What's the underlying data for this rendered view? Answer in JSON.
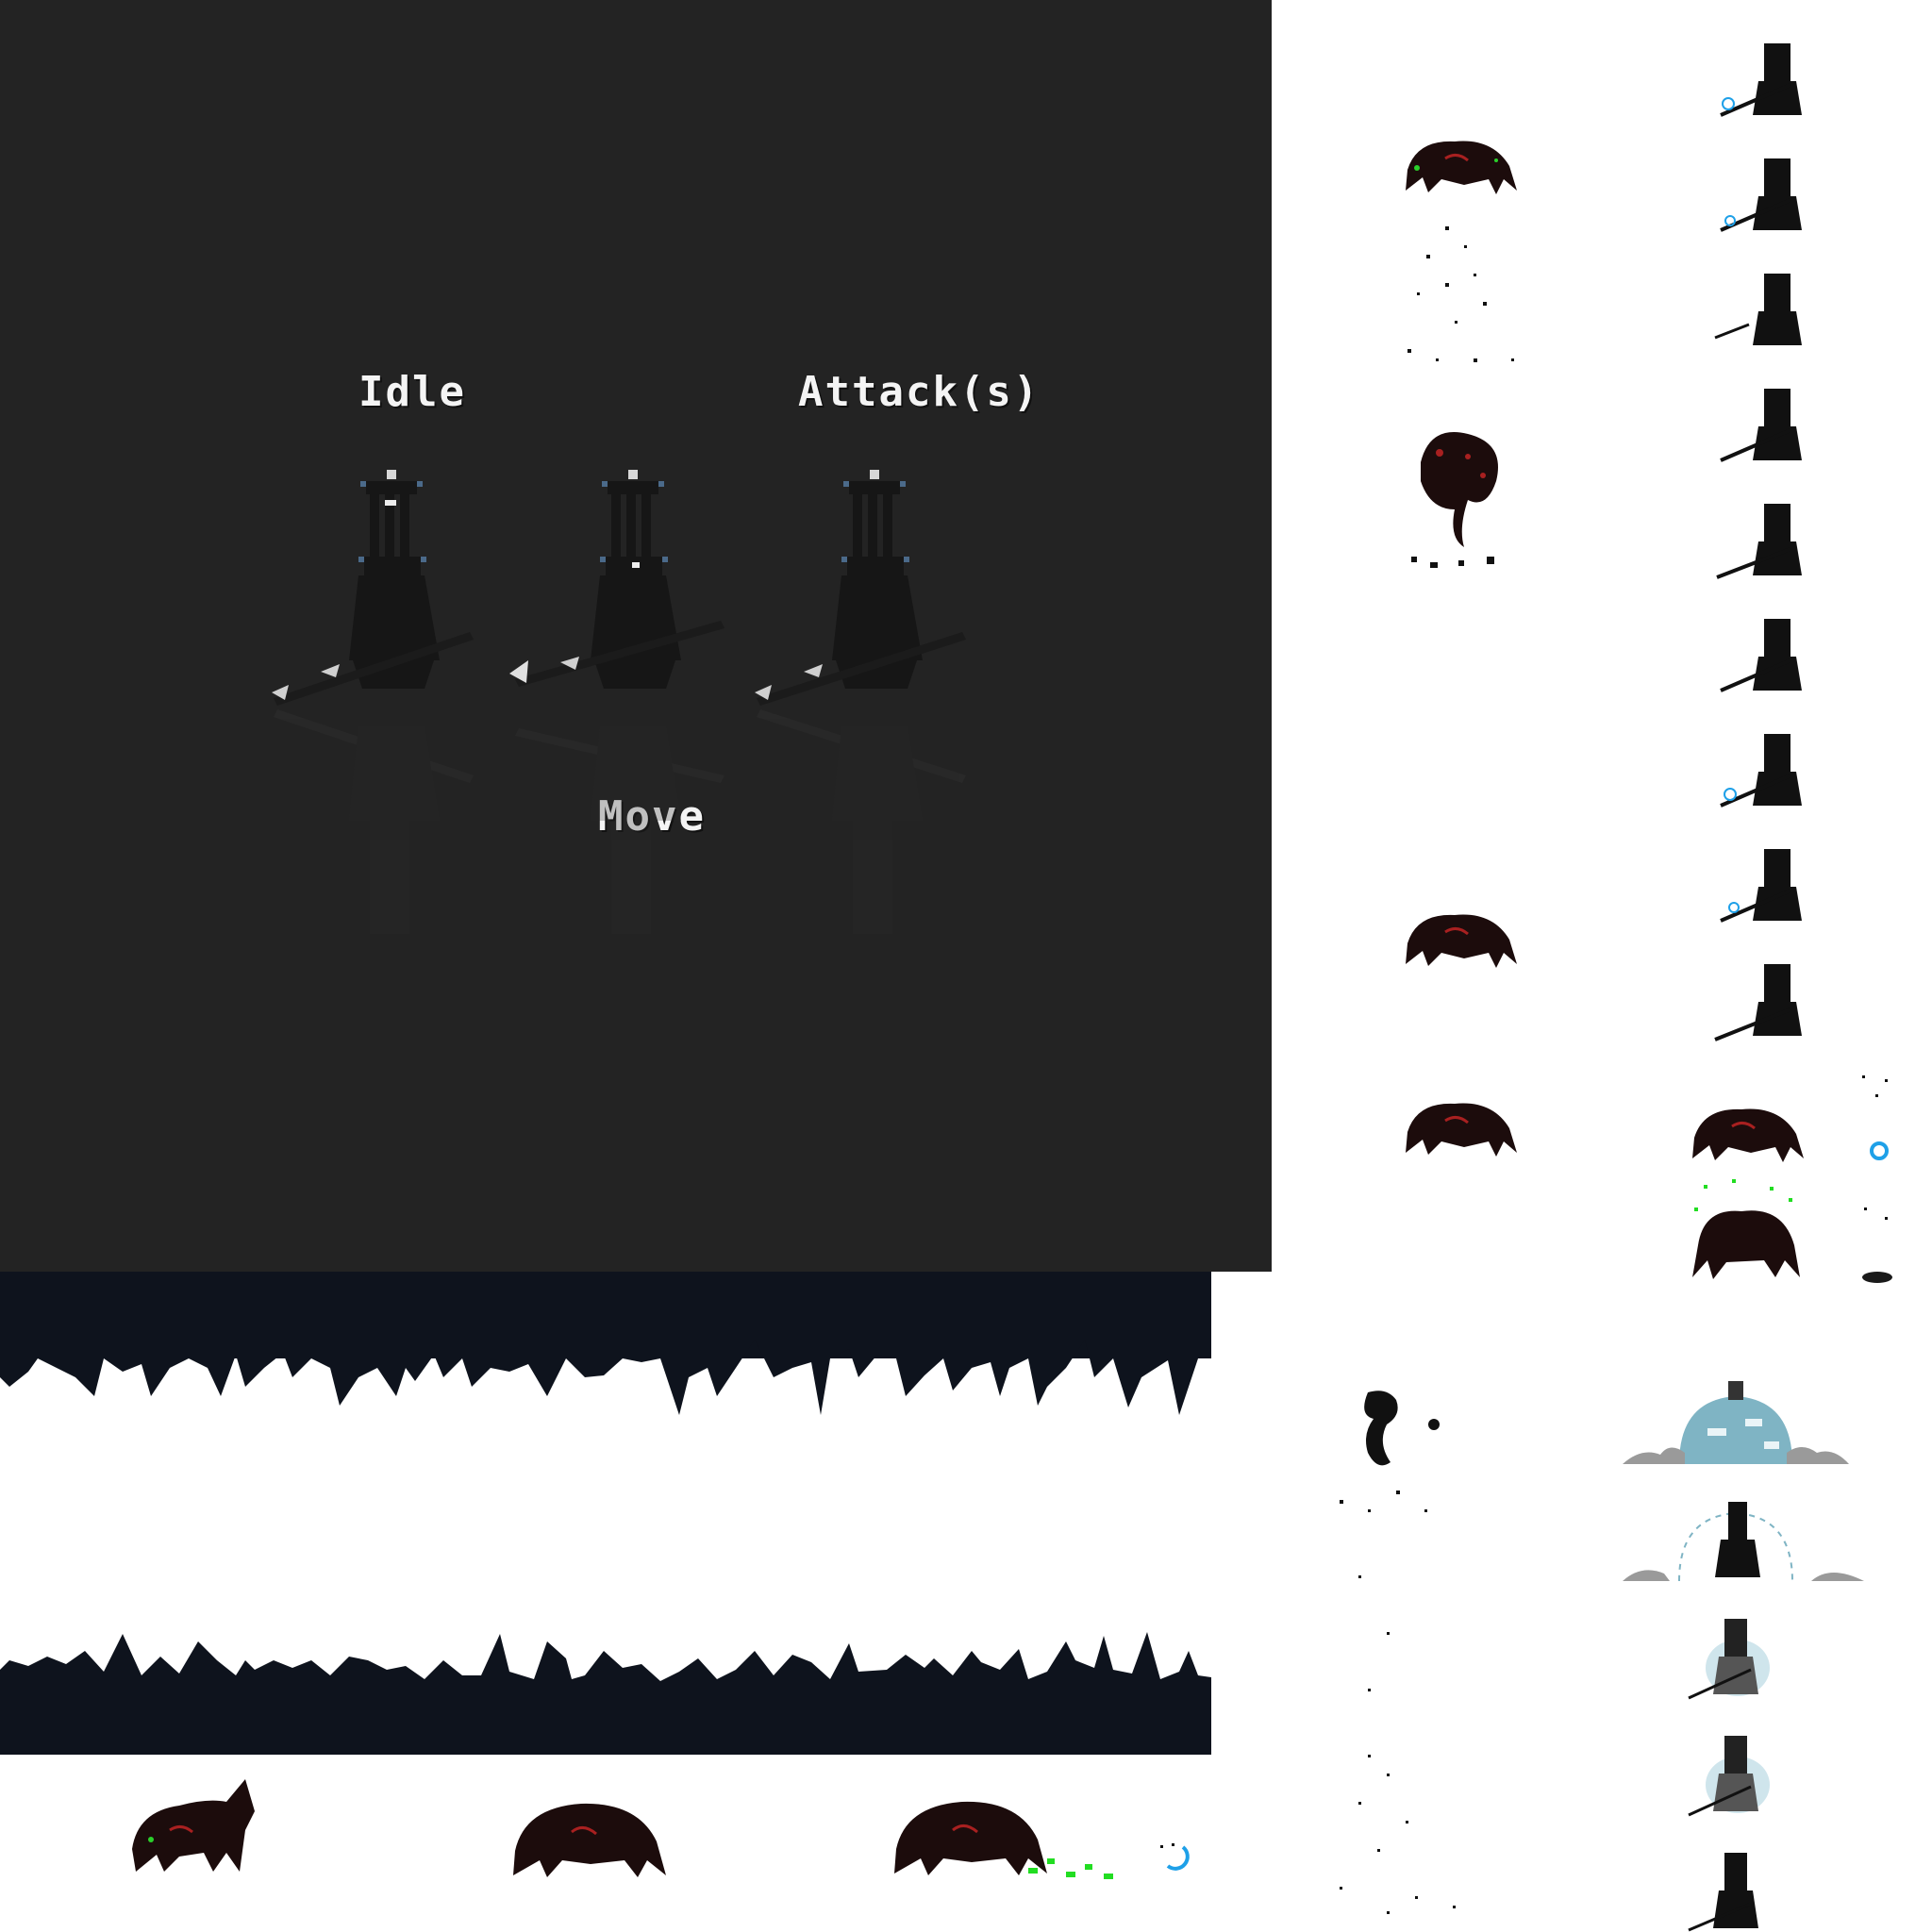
{
  "preview": {
    "labels": {
      "idle": "Idle",
      "attack": "Attack(s)",
      "move": "Move"
    },
    "colors": {
      "background": "#232323",
      "text": "#f4f4f4"
    }
  },
  "sheet": {
    "colors": {
      "background": "#ffffff",
      "cave_strip": "#0e131d",
      "creature_body": "#2a1010",
      "creature_accent": "#d22a2a",
      "slime": "#22dd22",
      "orb": "#1ea0e8",
      "shield": "#7fb4c4"
    },
    "sprites": {
      "creatures": "spider-creature-icon",
      "reaper": "hooded-reaper-icon",
      "tentacle": "tentacle-blob-icon",
      "shield_dome": "shield-dome-icon"
    }
  }
}
